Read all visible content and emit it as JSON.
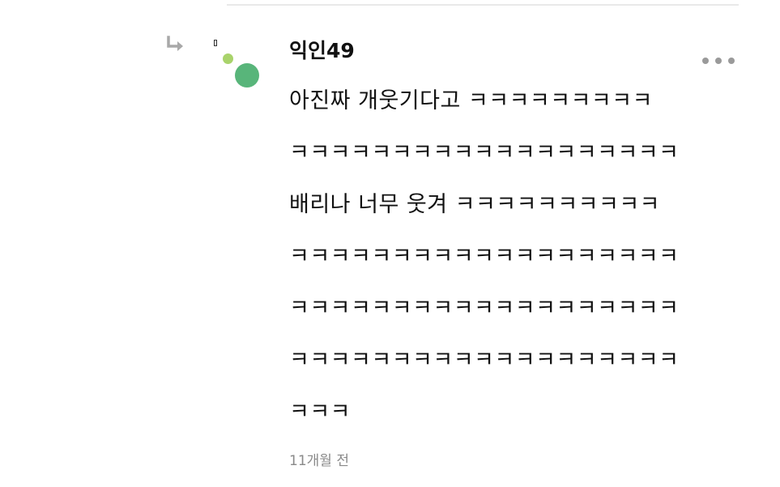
{
  "comment": {
    "username": "익인49",
    "lines": [
      "아진짜 개웃기다고 ㅋㅋㅋㅋㅋㅋㅋㅋㅋ",
      "ㅋㅋㅋㅋㅋㅋㅋㅋㅋㅋㅋㅋㅋㅋㅋㅋㅋㅋㅋ",
      "배리나 너무 웃겨 ㅋㅋㅋㅋㅋㅋㅋㅋㅋㅋ",
      "ㅋㅋㅋㅋㅋㅋㅋㅋㅋㅋㅋㅋㅋㅋㅋㅋㅋㅋㅋ",
      "ㅋㅋㅋㅋㅋㅋㅋㅋㅋㅋㅋㅋㅋㅋㅋㅋㅋㅋㅋ",
      "ㅋㅋㅋㅋㅋㅋㅋㅋㅋㅋㅋㅋㅋㅋㅋㅋㅋㅋㅋ",
      "ㅋㅋㅋ"
    ],
    "timestamp": "11개월 전"
  },
  "icons": {
    "reply": "reply-arrow-icon",
    "more": "more-dots-icon"
  },
  "colors": {
    "avatar_small_dot": "#a9d36b",
    "avatar_large_dot": "#58b57a",
    "timestamp_text": "#8a8a8a",
    "menu_dots": "#9a9a9a"
  }
}
